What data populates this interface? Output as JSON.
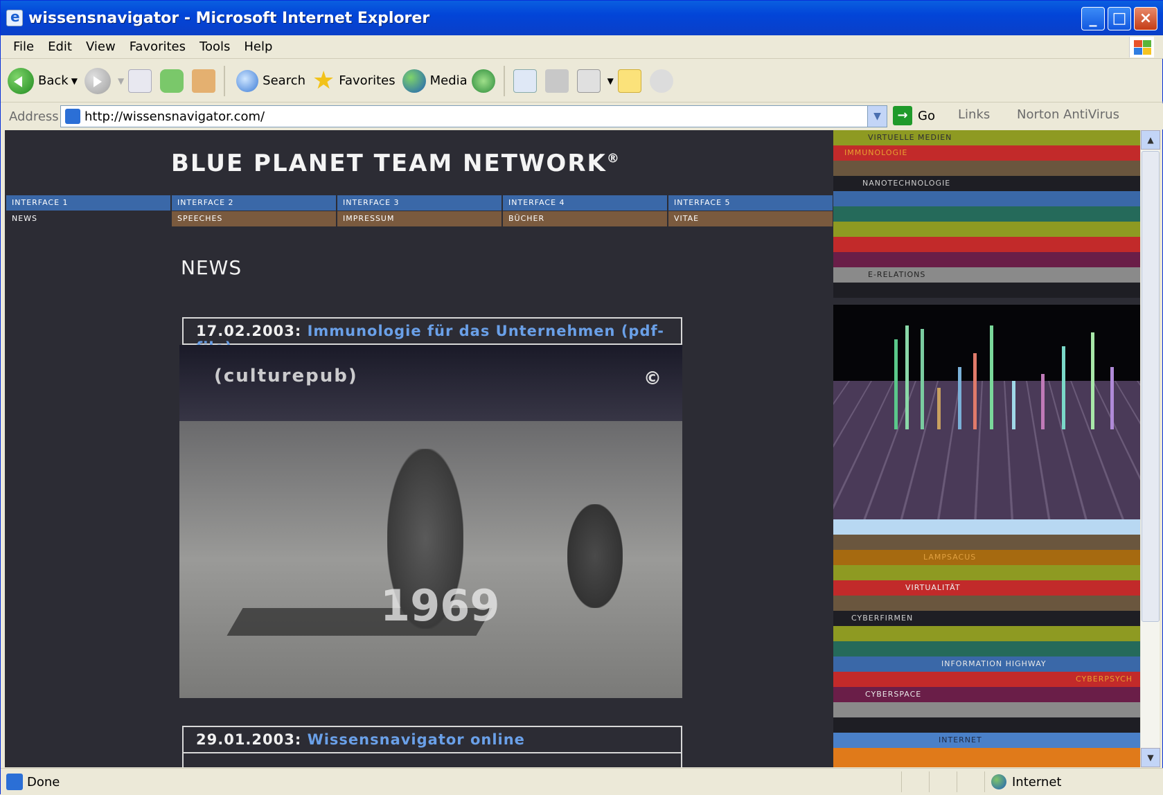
{
  "window": {
    "title": "wissensnavigator - Microsoft Internet Explorer"
  },
  "menu": [
    "File",
    "Edit",
    "View",
    "Favorites",
    "Tools",
    "Help"
  ],
  "toolbar": {
    "back": "Back",
    "search": "Search",
    "favorites": "Favorites",
    "media": "Media"
  },
  "address": {
    "label": "Address",
    "url": "http://wissensnavigator.com/",
    "go": "Go",
    "links": "Links",
    "norton": "Norton AntiVirus"
  },
  "page": {
    "brand": "BLUE PLANET TEAM NETWORK",
    "brand_mark": "®",
    "nav_top": [
      "INTERFACE 1",
      "INTERFACE 2",
      "INTERFACE 3",
      "INTERFACE 4",
      "INTERFACE 5"
    ],
    "nav_bottom": [
      "NEWS",
      "SPEECHES",
      "IMPRESSUM",
      "BÜCHER",
      "VITAE"
    ],
    "heading": "NEWS",
    "news": [
      {
        "date": "17.02.2003:",
        "title": "Immunologie für das Unternehmen (pdf-file)"
      },
      {
        "date": "29.01.2003:",
        "title": "Wissensnavigator online"
      }
    ],
    "video": {
      "label": "(culturepub)",
      "year": "1969",
      "mark": "©"
    },
    "side_labels": [
      "VIRTUELLE MEDIEN",
      "IMMUNOLOGIE",
      "NANOTECHNOLOGIE",
      "E-RELATIONS",
      "LAMPSACUS",
      "VIRTUALITÄT",
      "CYBERFIRMEN",
      "INFORMATION HIGHWAY",
      "CYBERPSYCH",
      "CYBERSPACE",
      "INTERNET"
    ]
  },
  "colors": {
    "accent": "#6aa0e8",
    "nav_top": "#3a68a8",
    "nav_bottom": "#7a5a3e",
    "background": "#2c2c34"
  },
  "status": {
    "text": "Done",
    "zone": "Internet"
  }
}
